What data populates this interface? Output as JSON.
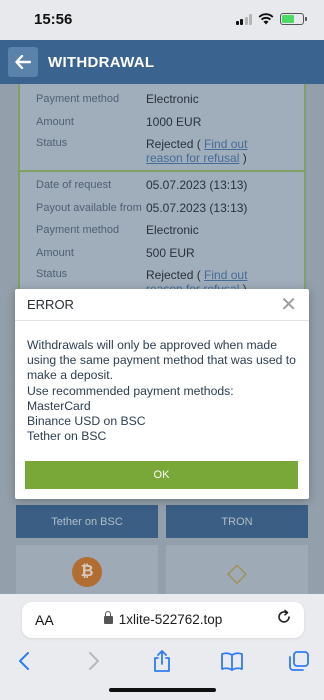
{
  "status_bar": {
    "time": "15:56"
  },
  "header": {
    "title": "WITHDRAWAL",
    "back_icon": "arrow-left-icon"
  },
  "card1": {
    "rows": [
      {
        "label": "Payment method",
        "value": "Electronic"
      },
      {
        "label": "Amount",
        "value": "1000 EUR"
      },
      {
        "label": "Status",
        "value_prefix": "Rejected (",
        "link": "Find out reason for refusal",
        "value_suffix": ")"
      }
    ]
  },
  "card2": {
    "rows": [
      {
        "label": "Date of request",
        "value": "05.07.2023 (13:13)"
      },
      {
        "label": "Payout available from",
        "value": "05.07.2023 (13:13)"
      },
      {
        "label": "Payment method",
        "value": "Electronic"
      },
      {
        "label": "Amount",
        "value": "500 EUR"
      },
      {
        "label": "Status",
        "value_prefix": "Rejected (",
        "link": "Find out reason for refusal",
        "value_suffix": ")"
      }
    ]
  },
  "payment_tiles": {
    "tether_bsc": "Tether on BSC",
    "tron": "TRON"
  },
  "modal": {
    "title": "ERROR",
    "lines": [
      "Withdrawals will only be approved when made using the same payment method that was used to make a deposit.",
      "Use recommended payment methods:",
      "MasterCard",
      "Binance USD on BSC",
      "Tether on BSC"
    ],
    "ok_label": "OK",
    "ok_color": "#79a838"
  },
  "browser": {
    "text_size_label": "AA",
    "url": "1xlite-522762.top",
    "icons": [
      "back-icon",
      "forward-icon",
      "share-icon",
      "bookmarks-icon",
      "tabs-icon",
      "reload-icon",
      "lock-icon"
    ]
  },
  "colors": {
    "header_bg": "#3a638f",
    "card_border": "#8fb66a",
    "link": "#4a75a8"
  }
}
